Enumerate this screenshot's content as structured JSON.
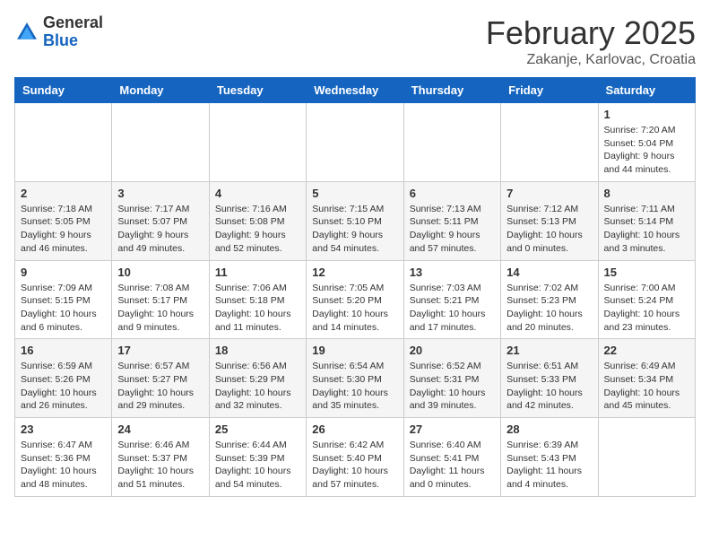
{
  "header": {
    "logo_general": "General",
    "logo_blue": "Blue",
    "month": "February 2025",
    "location": "Zakanje, Karlovac, Croatia"
  },
  "days_of_week": [
    "Sunday",
    "Monday",
    "Tuesday",
    "Wednesday",
    "Thursday",
    "Friday",
    "Saturday"
  ],
  "weeks": [
    [
      {
        "day": "",
        "info": ""
      },
      {
        "day": "",
        "info": ""
      },
      {
        "day": "",
        "info": ""
      },
      {
        "day": "",
        "info": ""
      },
      {
        "day": "",
        "info": ""
      },
      {
        "day": "",
        "info": ""
      },
      {
        "day": "1",
        "info": "Sunrise: 7:20 AM\nSunset: 5:04 PM\nDaylight: 9 hours and 44 minutes."
      }
    ],
    [
      {
        "day": "2",
        "info": "Sunrise: 7:18 AM\nSunset: 5:05 PM\nDaylight: 9 hours and 46 minutes."
      },
      {
        "day": "3",
        "info": "Sunrise: 7:17 AM\nSunset: 5:07 PM\nDaylight: 9 hours and 49 minutes."
      },
      {
        "day": "4",
        "info": "Sunrise: 7:16 AM\nSunset: 5:08 PM\nDaylight: 9 hours and 52 minutes."
      },
      {
        "day": "5",
        "info": "Sunrise: 7:15 AM\nSunset: 5:10 PM\nDaylight: 9 hours and 54 minutes."
      },
      {
        "day": "6",
        "info": "Sunrise: 7:13 AM\nSunset: 5:11 PM\nDaylight: 9 hours and 57 minutes."
      },
      {
        "day": "7",
        "info": "Sunrise: 7:12 AM\nSunset: 5:13 PM\nDaylight: 10 hours and 0 minutes."
      },
      {
        "day": "8",
        "info": "Sunrise: 7:11 AM\nSunset: 5:14 PM\nDaylight: 10 hours and 3 minutes."
      }
    ],
    [
      {
        "day": "9",
        "info": "Sunrise: 7:09 AM\nSunset: 5:15 PM\nDaylight: 10 hours and 6 minutes."
      },
      {
        "day": "10",
        "info": "Sunrise: 7:08 AM\nSunset: 5:17 PM\nDaylight: 10 hours and 9 minutes."
      },
      {
        "day": "11",
        "info": "Sunrise: 7:06 AM\nSunset: 5:18 PM\nDaylight: 10 hours and 11 minutes."
      },
      {
        "day": "12",
        "info": "Sunrise: 7:05 AM\nSunset: 5:20 PM\nDaylight: 10 hours and 14 minutes."
      },
      {
        "day": "13",
        "info": "Sunrise: 7:03 AM\nSunset: 5:21 PM\nDaylight: 10 hours and 17 minutes."
      },
      {
        "day": "14",
        "info": "Sunrise: 7:02 AM\nSunset: 5:23 PM\nDaylight: 10 hours and 20 minutes."
      },
      {
        "day": "15",
        "info": "Sunrise: 7:00 AM\nSunset: 5:24 PM\nDaylight: 10 hours and 23 minutes."
      }
    ],
    [
      {
        "day": "16",
        "info": "Sunrise: 6:59 AM\nSunset: 5:26 PM\nDaylight: 10 hours and 26 minutes."
      },
      {
        "day": "17",
        "info": "Sunrise: 6:57 AM\nSunset: 5:27 PM\nDaylight: 10 hours and 29 minutes."
      },
      {
        "day": "18",
        "info": "Sunrise: 6:56 AM\nSunset: 5:29 PM\nDaylight: 10 hours and 32 minutes."
      },
      {
        "day": "19",
        "info": "Sunrise: 6:54 AM\nSunset: 5:30 PM\nDaylight: 10 hours and 35 minutes."
      },
      {
        "day": "20",
        "info": "Sunrise: 6:52 AM\nSunset: 5:31 PM\nDaylight: 10 hours and 39 minutes."
      },
      {
        "day": "21",
        "info": "Sunrise: 6:51 AM\nSunset: 5:33 PM\nDaylight: 10 hours and 42 minutes."
      },
      {
        "day": "22",
        "info": "Sunrise: 6:49 AM\nSunset: 5:34 PM\nDaylight: 10 hours and 45 minutes."
      }
    ],
    [
      {
        "day": "23",
        "info": "Sunrise: 6:47 AM\nSunset: 5:36 PM\nDaylight: 10 hours and 48 minutes."
      },
      {
        "day": "24",
        "info": "Sunrise: 6:46 AM\nSunset: 5:37 PM\nDaylight: 10 hours and 51 minutes."
      },
      {
        "day": "25",
        "info": "Sunrise: 6:44 AM\nSunset: 5:39 PM\nDaylight: 10 hours and 54 minutes."
      },
      {
        "day": "26",
        "info": "Sunrise: 6:42 AM\nSunset: 5:40 PM\nDaylight: 10 hours and 57 minutes."
      },
      {
        "day": "27",
        "info": "Sunrise: 6:40 AM\nSunset: 5:41 PM\nDaylight: 11 hours and 0 minutes."
      },
      {
        "day": "28",
        "info": "Sunrise: 6:39 AM\nSunset: 5:43 PM\nDaylight: 11 hours and 4 minutes."
      },
      {
        "day": "",
        "info": ""
      }
    ]
  ]
}
